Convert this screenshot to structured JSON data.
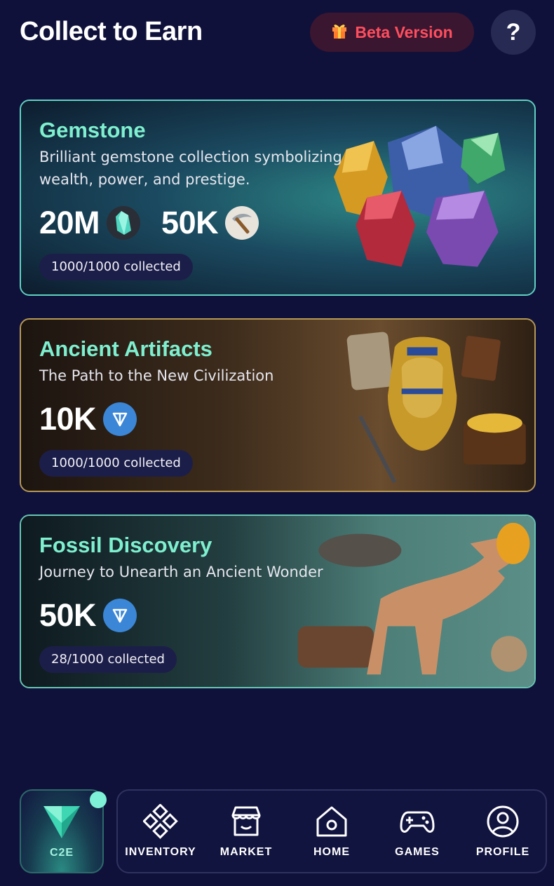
{
  "header": {
    "title": "Collect to Earn",
    "beta_label": "Beta Version",
    "help_label": "?"
  },
  "cards": [
    {
      "title": "Gemstone",
      "subtitle": "Brilliant gemstone collection symbolizing wealth, power, and prestige.",
      "rewards": [
        {
          "amount": "20M",
          "icon": "crystal-icon"
        },
        {
          "amount": "50K",
          "icon": "pickaxe-icon"
        }
      ],
      "collected": "1000/1000 collected"
    },
    {
      "title": "Ancient Artifacts",
      "subtitle": "The Path to the New Civilization",
      "rewards": [
        {
          "amount": "10K",
          "icon": "ton-icon"
        }
      ],
      "collected": "1000/1000 collected"
    },
    {
      "title": "Fossil Discovery",
      "subtitle": "Journey to Unearth an Ancient Wonder",
      "rewards": [
        {
          "amount": "50K",
          "icon": "ton-icon"
        }
      ],
      "collected": "28/1000 collected"
    }
  ],
  "nav": {
    "c2e_label": "C2E",
    "items": [
      {
        "label": "INVENTORY",
        "icon": "inventory-icon"
      },
      {
        "label": "MARKET",
        "icon": "market-icon"
      },
      {
        "label": "HOME",
        "icon": "home-icon"
      },
      {
        "label": "GAMES",
        "icon": "gamepad-icon"
      },
      {
        "label": "PROFILE",
        "icon": "profile-icon"
      }
    ]
  },
  "colors": {
    "background": "#10113a",
    "title_accent": "#7ef0cf",
    "beta_text": "#ff4e5e",
    "ton_blue": "#3b86d6"
  }
}
